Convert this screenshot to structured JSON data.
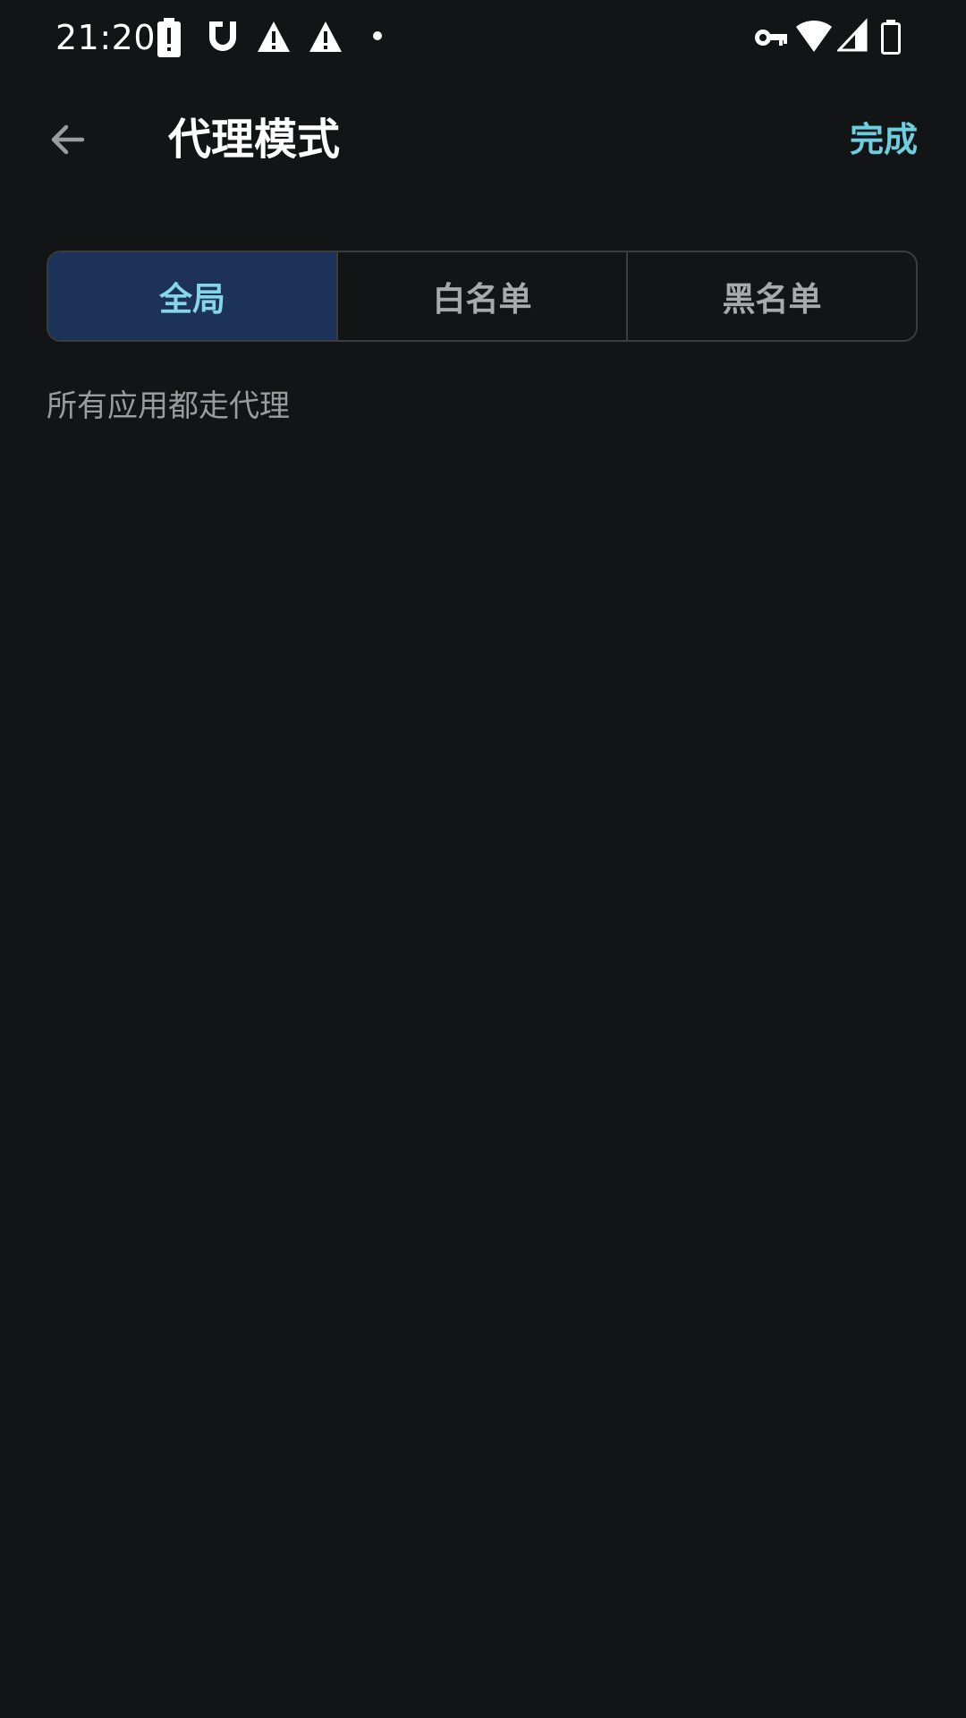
{
  "status_bar": {
    "time": "21:20",
    "icons_left": [
      "battery-alert-icon",
      "magnet-icon",
      "warning-icon",
      "warning-icon",
      "dot-icon"
    ],
    "icons_right": [
      "vpn-key-icon",
      "wifi-icon",
      "cell-signal-icon",
      "battery-icon"
    ]
  },
  "app_bar": {
    "title": "代理模式",
    "done_label": "完成",
    "back_icon": "arrow-back-icon"
  },
  "mode_selector": {
    "options": [
      {
        "label": "全局",
        "selected": true
      },
      {
        "label": "白名单",
        "selected": false
      },
      {
        "label": "黑名单",
        "selected": false
      }
    ]
  },
  "description": "所有应用都走代理",
  "colors": {
    "background": "#131416",
    "accent": "#6ccfe0",
    "selected_segment_bg": "#1c3259",
    "selected_segment_text": "#86d6ea",
    "segment_text": "#a7a9ad",
    "description_text": "#9a9ca0"
  }
}
